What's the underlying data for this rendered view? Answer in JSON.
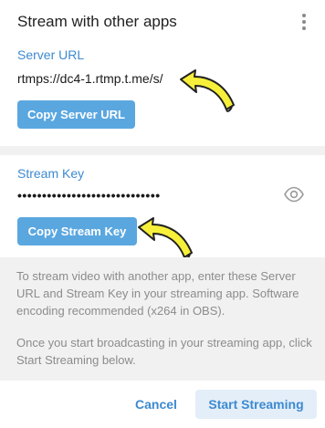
{
  "dialog": {
    "title": "Stream with other apps",
    "menu_icon": "more-vertical-icon"
  },
  "server": {
    "label": "Server URL",
    "value": "rtmps://dc4-1.rtmp.t.me/s/",
    "copy_button": "Copy Server URL"
  },
  "stream_key": {
    "label": "Stream Key",
    "masked_value": "•••••••••••••••••••••••••••••",
    "copy_button": "Copy Stream Key",
    "reveal_icon": "eye-icon"
  },
  "info": {
    "paragraph1": "To stream video with another app, enter these Server URL and Stream Key in your streaming app. Software encoding recommended (x264 in OBS).",
    "paragraph2": "Once you start broadcasting in your streaming app, click Start Streaming below."
  },
  "footer": {
    "cancel_label": "Cancel",
    "start_label": "Start Streaming"
  },
  "colors": {
    "accent": "#3d8ad0",
    "button_fill": "#5aa7e0",
    "annotation_arrow": "#f7f03a"
  }
}
